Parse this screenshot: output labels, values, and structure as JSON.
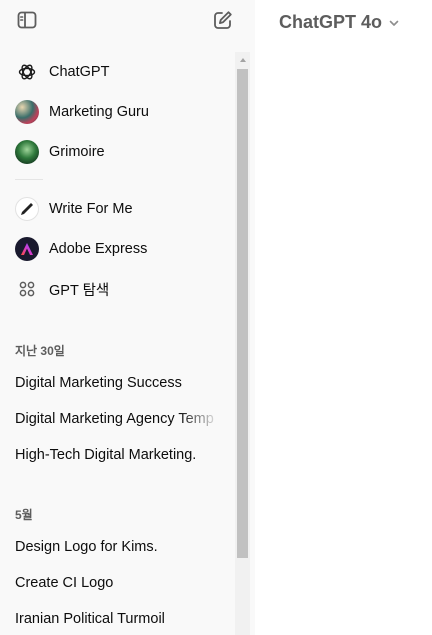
{
  "sidebar": {
    "toggle_icon": "sidebar-toggle-icon",
    "new_chat_icon": "edit-icon",
    "pinned": [
      {
        "label": "ChatGPT",
        "icon": "openai-logo-icon"
      },
      {
        "label": "Marketing Guru",
        "icon": "marketing-guru-avatar"
      },
      {
        "label": "Grimoire",
        "icon": "grimoire-avatar"
      }
    ],
    "gpts": [
      {
        "label": "Write For Me",
        "icon": "pen-avatar"
      },
      {
        "label": "Adobe Express",
        "icon": "adobe-express-avatar"
      },
      {
        "label": "GPT 탐색",
        "icon": "grid-icon"
      }
    ],
    "sections": [
      {
        "label": "지난 30일",
        "items": [
          "Digital Marketing Success",
          "Digital Marketing Agency Temp",
          "High-Tech Digital Marketing."
        ]
      },
      {
        "label": "5월",
        "items": [
          "Design Logo for Kims.",
          "Create CI Logo",
          "Iranian Political Turmoil"
        ]
      }
    ]
  },
  "main": {
    "model_name": "ChatGPT 4o",
    "model_dropdown_icon": "chevron-down-icon"
  },
  "colors": {
    "sidebar_bg": "#f9f9f9",
    "text": "#0d0d0d",
    "muted": "#5d5d5d",
    "adobe_bg": "#1a1a2e"
  }
}
